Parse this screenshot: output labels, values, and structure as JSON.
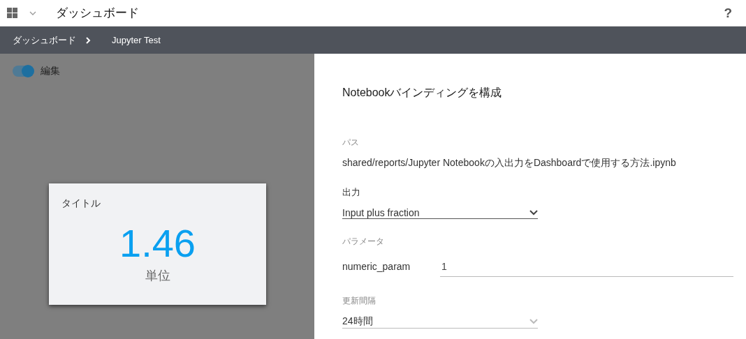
{
  "header": {
    "title": "ダッシュボード",
    "help": "?"
  },
  "breadcrumb": [
    {
      "label": "ダッシュボード"
    },
    {
      "label": "Jupyter Test"
    }
  ],
  "edit_toggle": {
    "label": "編集",
    "on": true
  },
  "tile": {
    "title": "タイトル",
    "value": "1.46",
    "unit": "単位"
  },
  "panel": {
    "title": "Notebookバインディングを構成",
    "path": {
      "label": "パス",
      "value": "shared/reports/Jupyter Notebookの入出力をDashboardで使用する方法.ipynb"
    },
    "output": {
      "label": "出力",
      "value": "Input plus fraction"
    },
    "parameters": {
      "label": "パラメータ",
      "items": [
        {
          "name": "numeric_param",
          "value": "1"
        }
      ]
    },
    "interval": {
      "label": "更新間隔",
      "value": "24時間"
    }
  }
}
